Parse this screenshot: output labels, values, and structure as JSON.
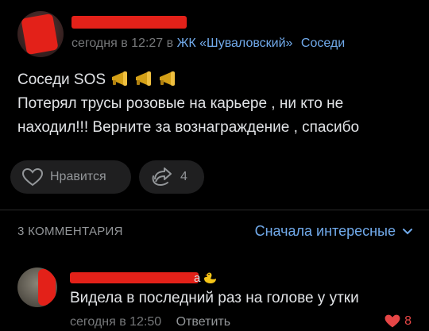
{
  "post": {
    "author_name": "",
    "time": "сегодня в 12:27",
    "in": "в",
    "group": "ЖК «Шуваловский»",
    "section": "Соседи",
    "body_line1": "Соседи SOS",
    "body_line2": "Потерял трусы розовые на карьере , ни кто не",
    "body_line3": "находил!!! Верните за вознаграждение , спасибо",
    "emoji": "megaphone-icon ×3"
  },
  "actions": {
    "like_label": "Нравится",
    "share_count": "4"
  },
  "comments": {
    "count_label": "3 КОММЕНТАРИЯ",
    "sort_label": "Сначала интересные"
  },
  "comment": {
    "name_suffix": "а",
    "text": "Видела в последний раз на голове у утки",
    "time": "сегодня в 12:50",
    "reply_label": "Ответить",
    "likes": "8"
  },
  "colors": {
    "background": "#000000",
    "text": "#e1e3e6",
    "muted": "#76787a",
    "link": "#71aaeb",
    "redaction": "#e32119",
    "like_red": "#e64646",
    "pill_bg": "#1f1f20"
  }
}
